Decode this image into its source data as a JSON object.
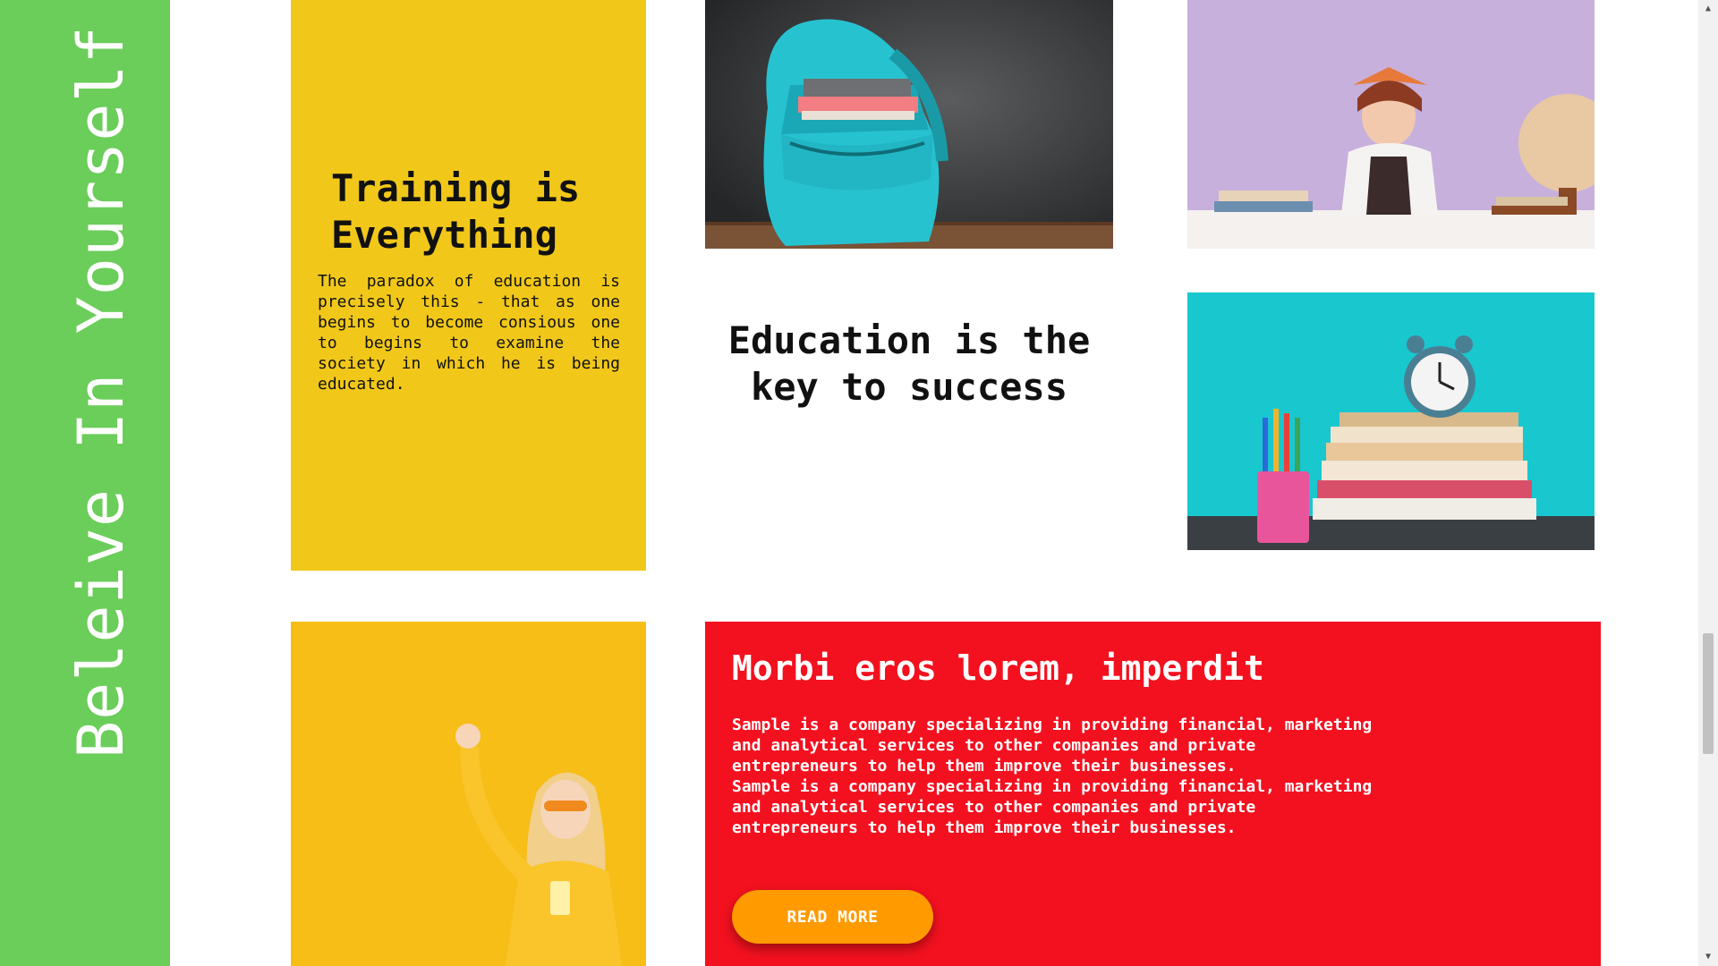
{
  "side_banner": {
    "text": "Beleive In Yourself"
  },
  "training_card": {
    "title": "Training is Everything",
    "text": "The paradox of education is precisely this - that as one begins to become consious one to begins to examine the society in which he is being educated."
  },
  "quote": {
    "text": "Education is the key to success"
  },
  "feature_card": {
    "title": "Morbi eros lorem, imperdit",
    "paragraphs": [
      "Sample is a company specializing in providing financial, marketing and analytical services to other companies and private entrepreneurs to help them improve their businesses.",
      "Sample is a company specializing in providing financial, marketing and analytical services to other companies and private entrepreneurs to help them improve their businesses."
    ],
    "button_label": "READ MORE"
  },
  "colors": {
    "green": "#6bcd5a",
    "yellow": "#f1c81a",
    "red": "#f3111f",
    "orange": "#ff9a00"
  }
}
